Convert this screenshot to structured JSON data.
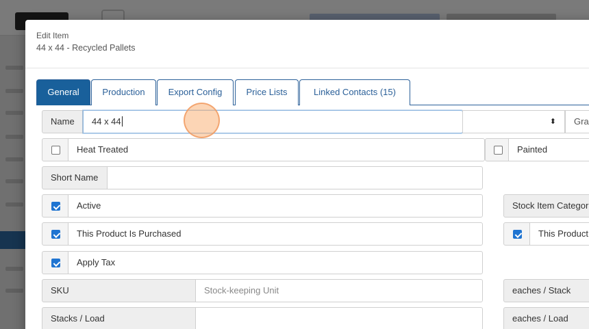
{
  "modal": {
    "title": "Edit Item",
    "subtitle": "44 x 44 - Recycled Pallets"
  },
  "tabs": [
    {
      "label": "General",
      "active": true
    },
    {
      "label": "Production",
      "active": false
    },
    {
      "label": "Export Config",
      "active": false
    },
    {
      "label": "Price Lists",
      "active": false
    },
    {
      "label": "Linked Contacts (15)",
      "active": false
    }
  ],
  "form": {
    "name_label": "Name",
    "name_value": "44 x 44",
    "select_arrows": "⬍",
    "grade_label": "Grac",
    "heat_treated_label": "Heat Treated",
    "heat_treated_checked": false,
    "painted_label": "Painted",
    "painted_checked": false,
    "short_name_label": "Short Name",
    "short_name_value": "",
    "active_label": "Active",
    "active_checked": true,
    "stock_item_category_label": "Stock Item Categor",
    "purchased_label": "This Product Is Purchased",
    "purchased_checked": true,
    "this_product_right_label": "This Product",
    "this_product_right_checked": true,
    "apply_tax_label": "Apply Tax",
    "apply_tax_checked": true,
    "sku_label": "SKU",
    "sku_placeholder": "Stock-keeping Unit",
    "eaches_stack_label": "eaches / Stack",
    "stacks_load_label": "Stacks / Load",
    "stacks_load_value": "",
    "eaches_load_label": "eaches / Load"
  },
  "colors": {
    "primary": "#19609b",
    "checkbox": "#1f74d1",
    "highlight": "#fab278"
  }
}
